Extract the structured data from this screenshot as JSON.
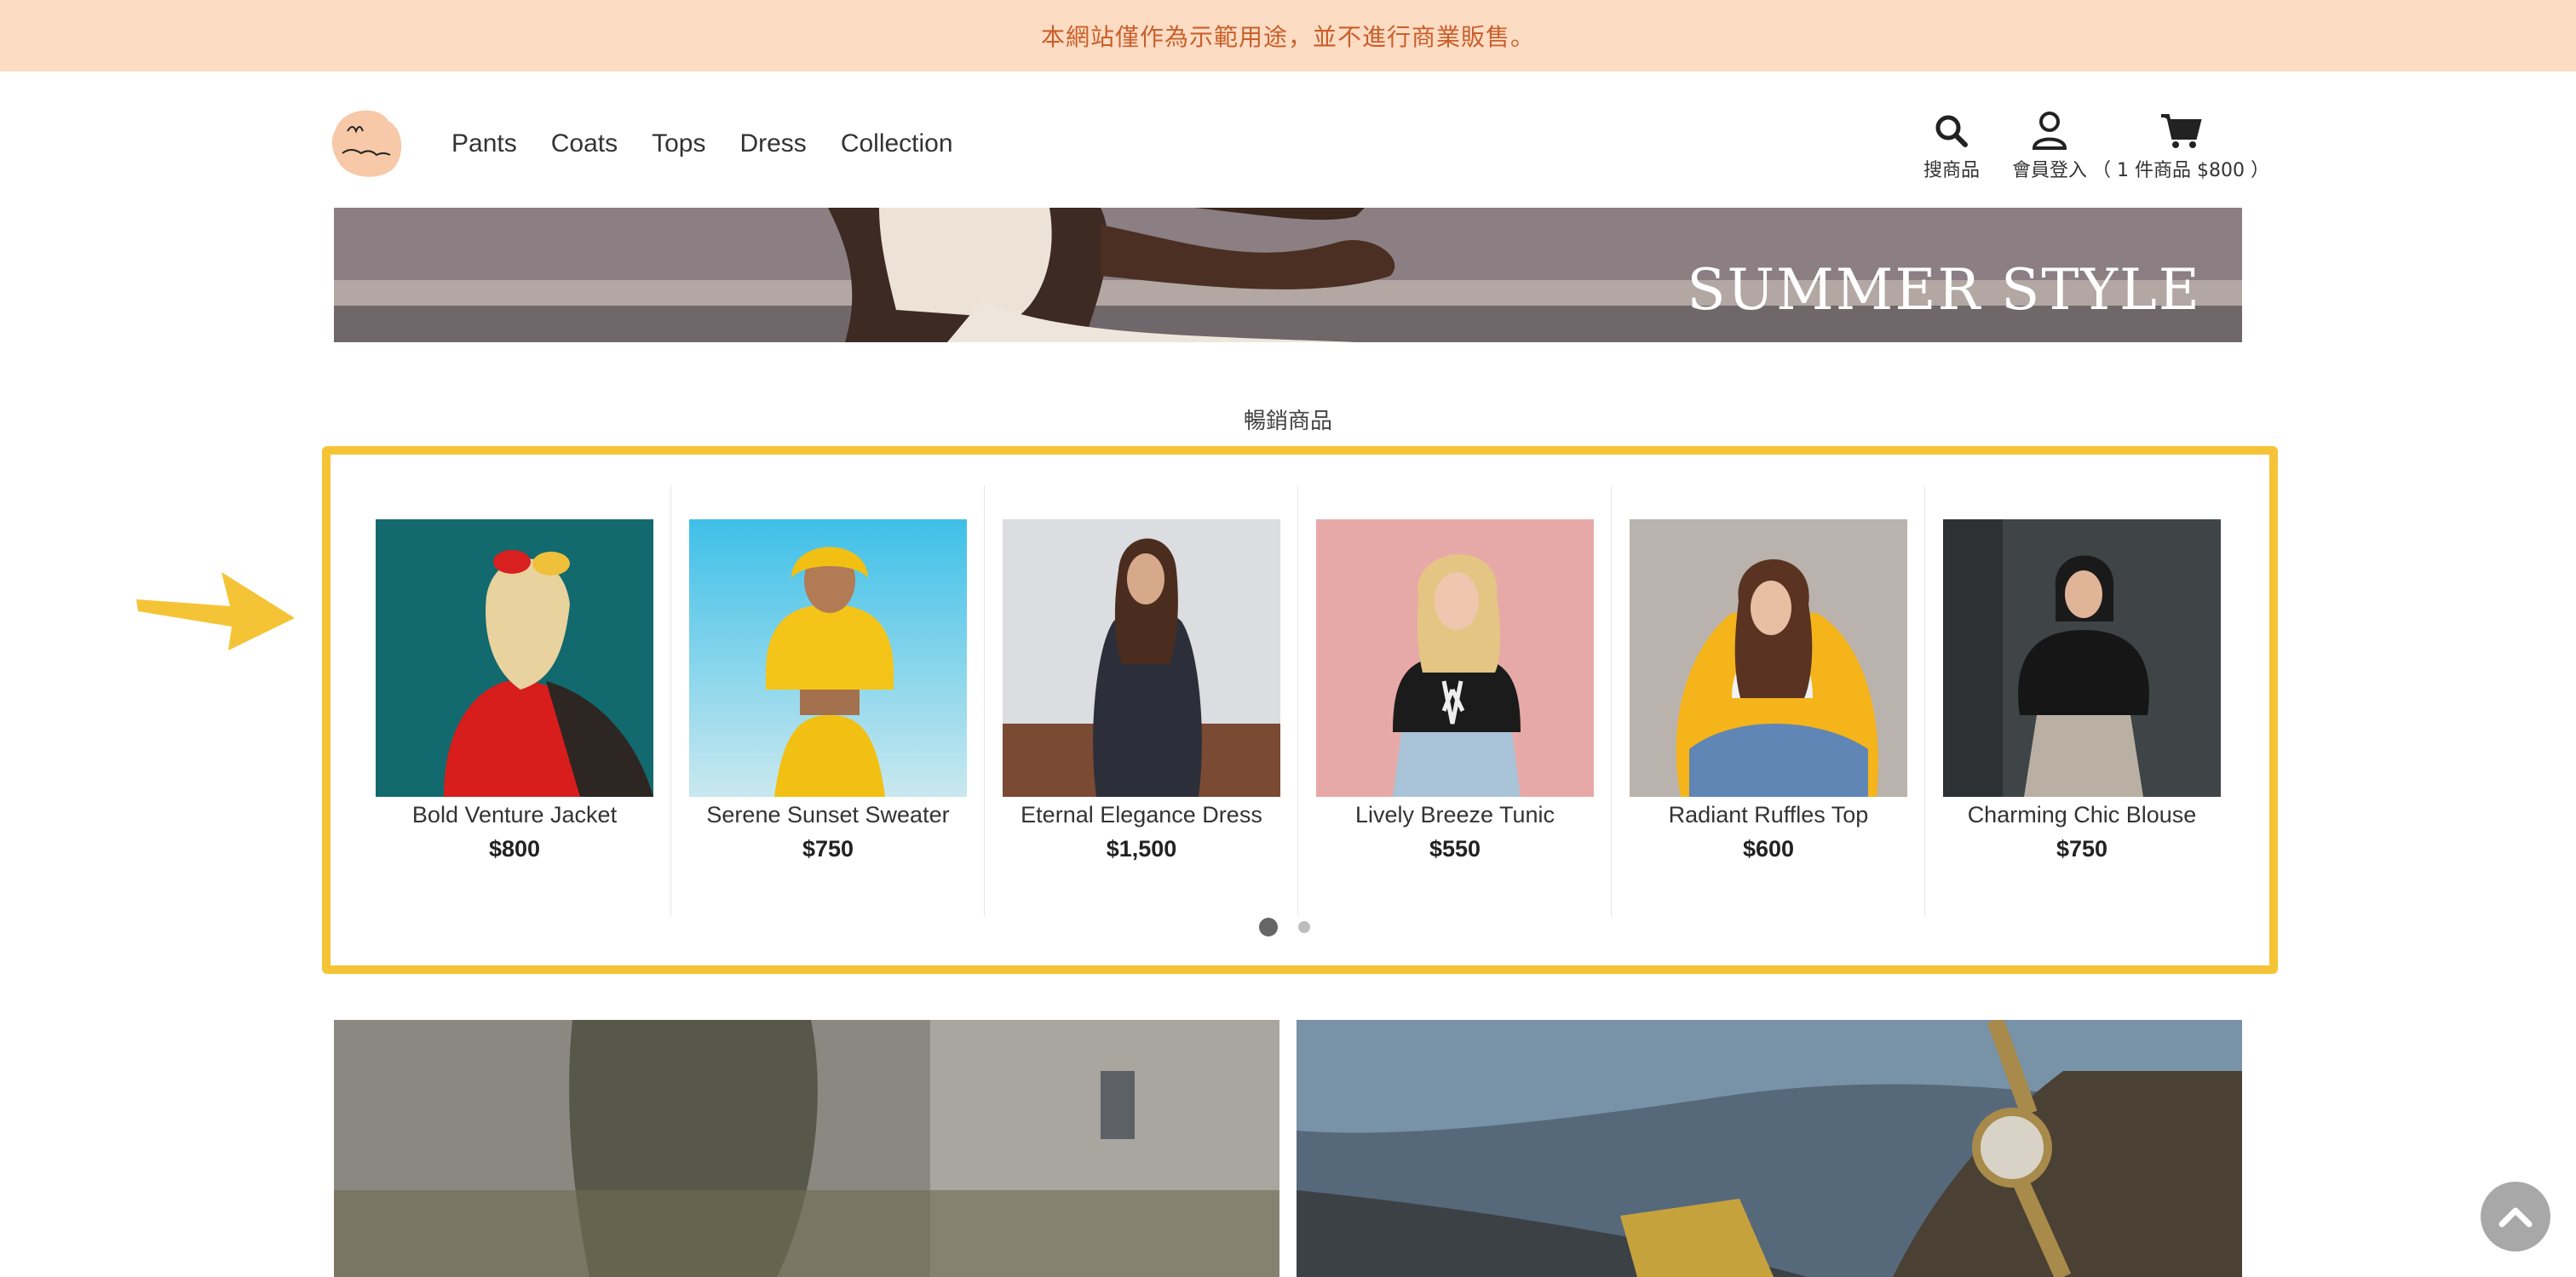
{
  "announcement": "本網站僅作為示範用途，並不進行商業販售。",
  "nav": {
    "items": [
      {
        "label": "Pants"
      },
      {
        "label": "Coats"
      },
      {
        "label": "Tops"
      },
      {
        "label": "Dress"
      },
      {
        "label": "Collection"
      }
    ]
  },
  "tools": {
    "search_label": "搜商品",
    "login_label": "會員登入",
    "cart_label": "（ 1 件商品 $800 ）",
    "search_icon": "search-icon",
    "login_icon": "user-icon",
    "cart_icon": "cart-icon"
  },
  "banner": {
    "title": "SUMMER STYLE"
  },
  "best_sellers": {
    "title": "暢銷商品",
    "products": [
      {
        "name": "Bold Venture Jacket",
        "price": "$800"
      },
      {
        "name": "Serene Sunset Sweater",
        "price": "$750"
      },
      {
        "name": "Eternal Elegance Dress",
        "price": "$1,500"
      },
      {
        "name": "Lively Breeze Tunic",
        "price": "$550"
      },
      {
        "name": "Radiant Ruffles Top",
        "price": "$600"
      },
      {
        "name": "Charming Chic Blouse",
        "price": "$750"
      }
    ],
    "pagination": {
      "pages": 2,
      "current": 1
    }
  },
  "colors": {
    "announce_bg": "#fddcc4",
    "announce_text": "#c95f2a",
    "highlight": "#f5c436"
  }
}
